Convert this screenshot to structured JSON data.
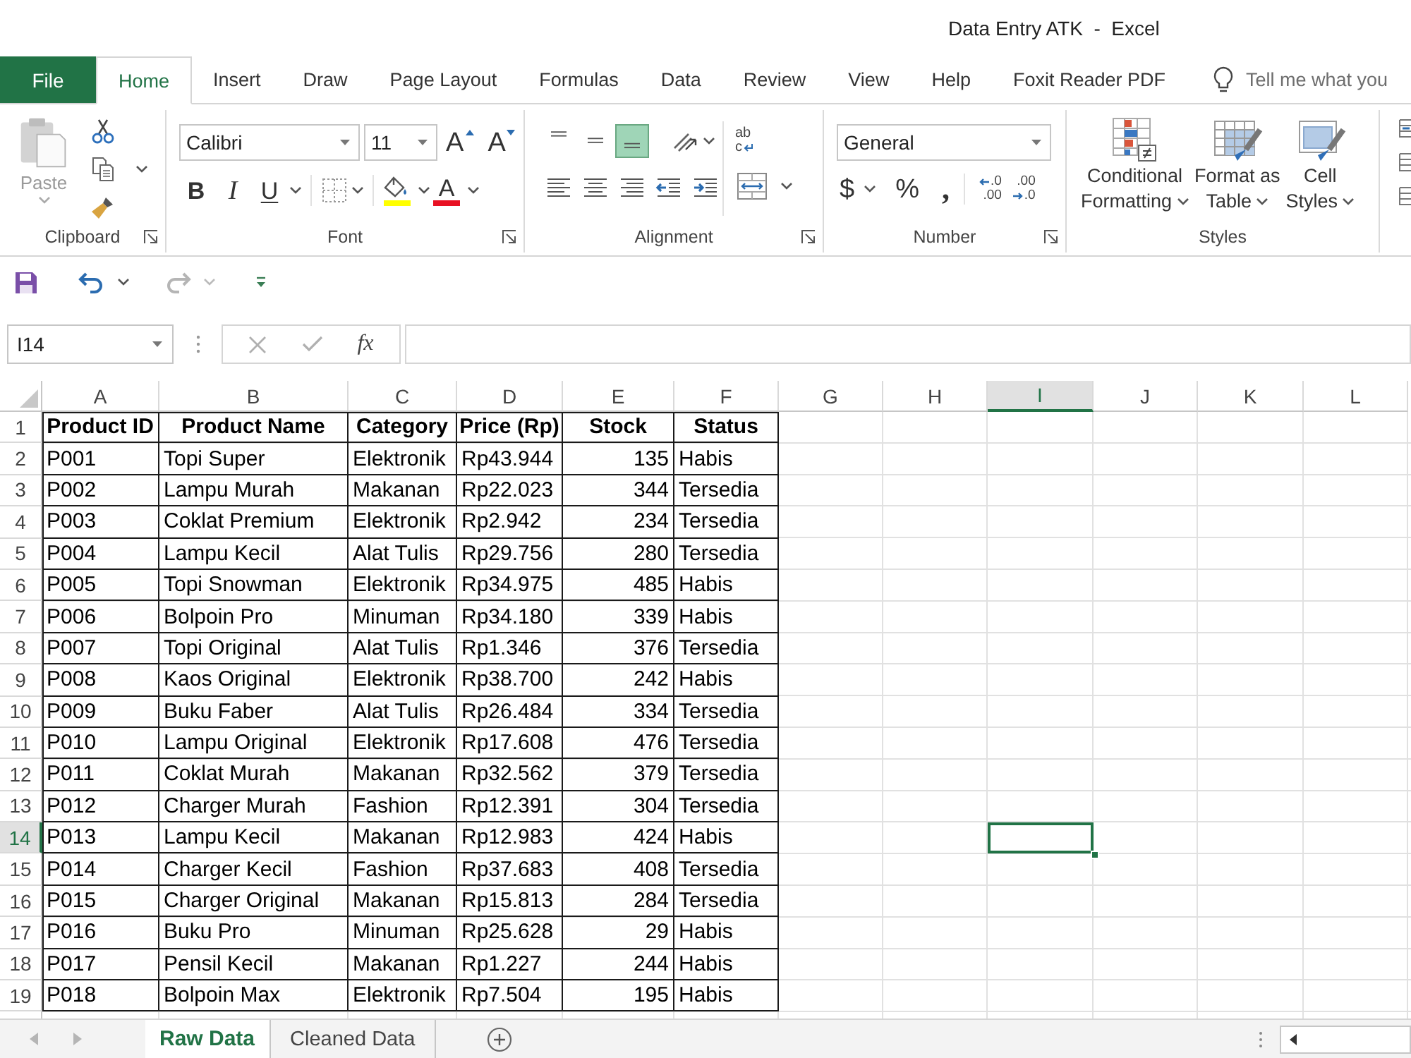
{
  "window": {
    "title": "Data Entry ATK  -  Excel"
  },
  "ribbon_tabs": [
    {
      "label": "File",
      "kind": "file",
      "selected": false
    },
    {
      "label": "Home",
      "kind": "tab",
      "selected": true
    },
    {
      "label": "Insert",
      "kind": "tab",
      "selected": false
    },
    {
      "label": "Draw",
      "kind": "tab",
      "selected": false
    },
    {
      "label": "Page Layout",
      "kind": "tab",
      "selected": false
    },
    {
      "label": "Formulas",
      "kind": "tab",
      "selected": false
    },
    {
      "label": "Data",
      "kind": "tab",
      "selected": false
    },
    {
      "label": "Review",
      "kind": "tab",
      "selected": false
    },
    {
      "label": "View",
      "kind": "tab",
      "selected": false
    },
    {
      "label": "Help",
      "kind": "tab",
      "selected": false
    },
    {
      "label": "Foxit Reader PDF",
      "kind": "tab",
      "selected": false
    }
  ],
  "tell_me": {
    "placeholder": "Tell me what you"
  },
  "ribbon": {
    "clipboard": {
      "label": "Clipboard",
      "paste": {
        "label": "Paste",
        "disabled": true
      }
    },
    "font": {
      "label": "Font",
      "font_name": "Calibri",
      "font_size": "11",
      "size_buttons": [
        {
          "kind": "grow",
          "label": "A"
        },
        {
          "kind": "shrink",
          "label": "A"
        }
      ],
      "style_buttons": [
        {
          "kind": "bold",
          "label": "B"
        },
        {
          "kind": "italic",
          "label": "I"
        },
        {
          "kind": "underline",
          "label": "U"
        }
      ],
      "color_buttons": [
        {
          "kind": "fill",
          "color": "#ffff00"
        },
        {
          "kind": "font",
          "label": "A",
          "color": "#e81123"
        }
      ]
    },
    "alignment": {
      "label": "Alignment",
      "vertical": [
        {
          "kind": "top",
          "selected": false
        },
        {
          "kind": "middle",
          "selected": false
        },
        {
          "kind": "bottom",
          "selected": true
        }
      ],
      "wrap_text": {
        "top": "ab",
        "bottom": "c"
      }
    },
    "number": {
      "label": "Number",
      "format": "General",
      "symbols": [
        "$",
        "%",
        ","
      ],
      "decimal_buttons": [
        {
          "kind": "increase",
          "top": ".0",
          "bottom": ".00"
        },
        {
          "kind": "decrease",
          "top": ".00",
          "bottom": ".0"
        }
      ]
    },
    "styles": {
      "label": "Styles",
      "buttons": [
        {
          "kind": "conditional",
          "lines": [
            "Conditional",
            "Formatting"
          ]
        },
        {
          "kind": "table",
          "lines": [
            "Format as",
            "Table"
          ]
        },
        {
          "kind": "cell",
          "lines": [
            "Cell",
            "Styles"
          ]
        }
      ]
    }
  },
  "quick_access": {
    "redo_disabled": true
  },
  "formula_bar": {
    "name_box": "I14",
    "function_label": "fx"
  },
  "sheet": {
    "columns": [
      {
        "label": "A",
        "selected": false
      },
      {
        "label": "B",
        "selected": false
      },
      {
        "label": "C",
        "selected": false
      },
      {
        "label": "D",
        "selected": false
      },
      {
        "label": "E",
        "selected": false
      },
      {
        "label": "F",
        "selected": false
      },
      {
        "label": "G",
        "selected": false
      },
      {
        "label": "H",
        "selected": false
      },
      {
        "label": "I",
        "selected": true
      },
      {
        "label": "J",
        "selected": false
      },
      {
        "label": "K",
        "selected": false
      },
      {
        "label": "L",
        "selected": false
      }
    ],
    "rows": [
      {
        "number": "1",
        "kind": "header",
        "selected": false,
        "cells": [
          "Product ID",
          "Product Name",
          "Category",
          "Price (Rp)",
          "Stock",
          "Status"
        ]
      },
      {
        "number": "2",
        "kind": "data",
        "selected": false,
        "cells": [
          "P001",
          "Topi Super",
          "Elektronik",
          "Rp43.944",
          "135",
          "Habis"
        ]
      },
      {
        "number": "3",
        "kind": "data",
        "selected": false,
        "cells": [
          "P002",
          "Lampu Murah",
          "Makanan",
          "Rp22.023",
          "344",
          "Tersedia"
        ]
      },
      {
        "number": "4",
        "kind": "data",
        "selected": false,
        "cells": [
          "P003",
          "Coklat Premium",
          "Elektronik",
          "Rp2.942",
          "234",
          "Tersedia"
        ]
      },
      {
        "number": "5",
        "kind": "data",
        "selected": false,
        "cells": [
          "P004",
          "Lampu Kecil",
          "Alat Tulis",
          "Rp29.756",
          "280",
          "Tersedia"
        ]
      },
      {
        "number": "6",
        "kind": "data",
        "selected": false,
        "cells": [
          "P005",
          "Topi Snowman",
          "Elektronik",
          "Rp34.975",
          "485",
          "Habis"
        ]
      },
      {
        "number": "7",
        "kind": "data",
        "selected": false,
        "cells": [
          "P006",
          "Bolpoin Pro",
          "Minuman",
          "Rp34.180",
          "339",
          "Habis"
        ]
      },
      {
        "number": "8",
        "kind": "data",
        "selected": false,
        "cells": [
          "P007",
          "Topi Original",
          "Alat Tulis",
          "Rp1.346",
          "376",
          "Tersedia"
        ]
      },
      {
        "number": "9",
        "kind": "data",
        "selected": false,
        "cells": [
          "P008",
          "Kaos Original",
          "Elektronik",
          "Rp38.700",
          "242",
          "Habis"
        ]
      },
      {
        "number": "10",
        "kind": "data",
        "selected": false,
        "cells": [
          "P009",
          "Buku Faber",
          "Alat Tulis",
          "Rp26.484",
          "334",
          "Tersedia"
        ]
      },
      {
        "number": "11",
        "kind": "data",
        "selected": false,
        "cells": [
          "P010",
          "Lampu Original",
          "Elektronik",
          "Rp17.608",
          "476",
          "Tersedia"
        ]
      },
      {
        "number": "12",
        "kind": "data",
        "selected": false,
        "cells": [
          "P011",
          "Coklat Murah",
          "Makanan",
          "Rp32.562",
          "379",
          "Tersedia"
        ]
      },
      {
        "number": "13",
        "kind": "data",
        "selected": false,
        "cells": [
          "P012",
          "Charger Murah",
          "Fashion",
          "Rp12.391",
          "304",
          "Tersedia"
        ]
      },
      {
        "number": "14",
        "kind": "data",
        "selected": true,
        "cells": [
          "P013",
          "Lampu Kecil",
          "Makanan",
          "Rp12.983",
          "424",
          "Habis"
        ]
      },
      {
        "number": "15",
        "kind": "data",
        "selected": false,
        "cells": [
          "P014",
          "Charger Kecil",
          "Fashion",
          "Rp37.683",
          "408",
          "Tersedia"
        ]
      },
      {
        "number": "16",
        "kind": "data",
        "selected": false,
        "cells": [
          "P015",
          "Charger Original",
          "Makanan",
          "Rp15.813",
          "284",
          "Tersedia"
        ]
      },
      {
        "number": "17",
        "kind": "data",
        "selected": false,
        "cells": [
          "P016",
          "Buku Pro",
          "Minuman",
          "Rp25.628",
          "29",
          "Habis"
        ]
      },
      {
        "number": "18",
        "kind": "data",
        "selected": false,
        "cells": [
          "P017",
          "Pensil Kecil",
          "Makanan",
          "Rp1.227",
          "244",
          "Habis"
        ]
      },
      {
        "number": "19",
        "kind": "data",
        "selected": false,
        "cells": [
          "P018",
          "Bolpoin Max",
          "Elektronik",
          "Rp7.504",
          "195",
          "Habis"
        ]
      }
    ]
  },
  "sheet_tabs": [
    {
      "label": "Raw Data",
      "selected": true
    },
    {
      "label": "Cleaned Data",
      "selected": false
    }
  ]
}
